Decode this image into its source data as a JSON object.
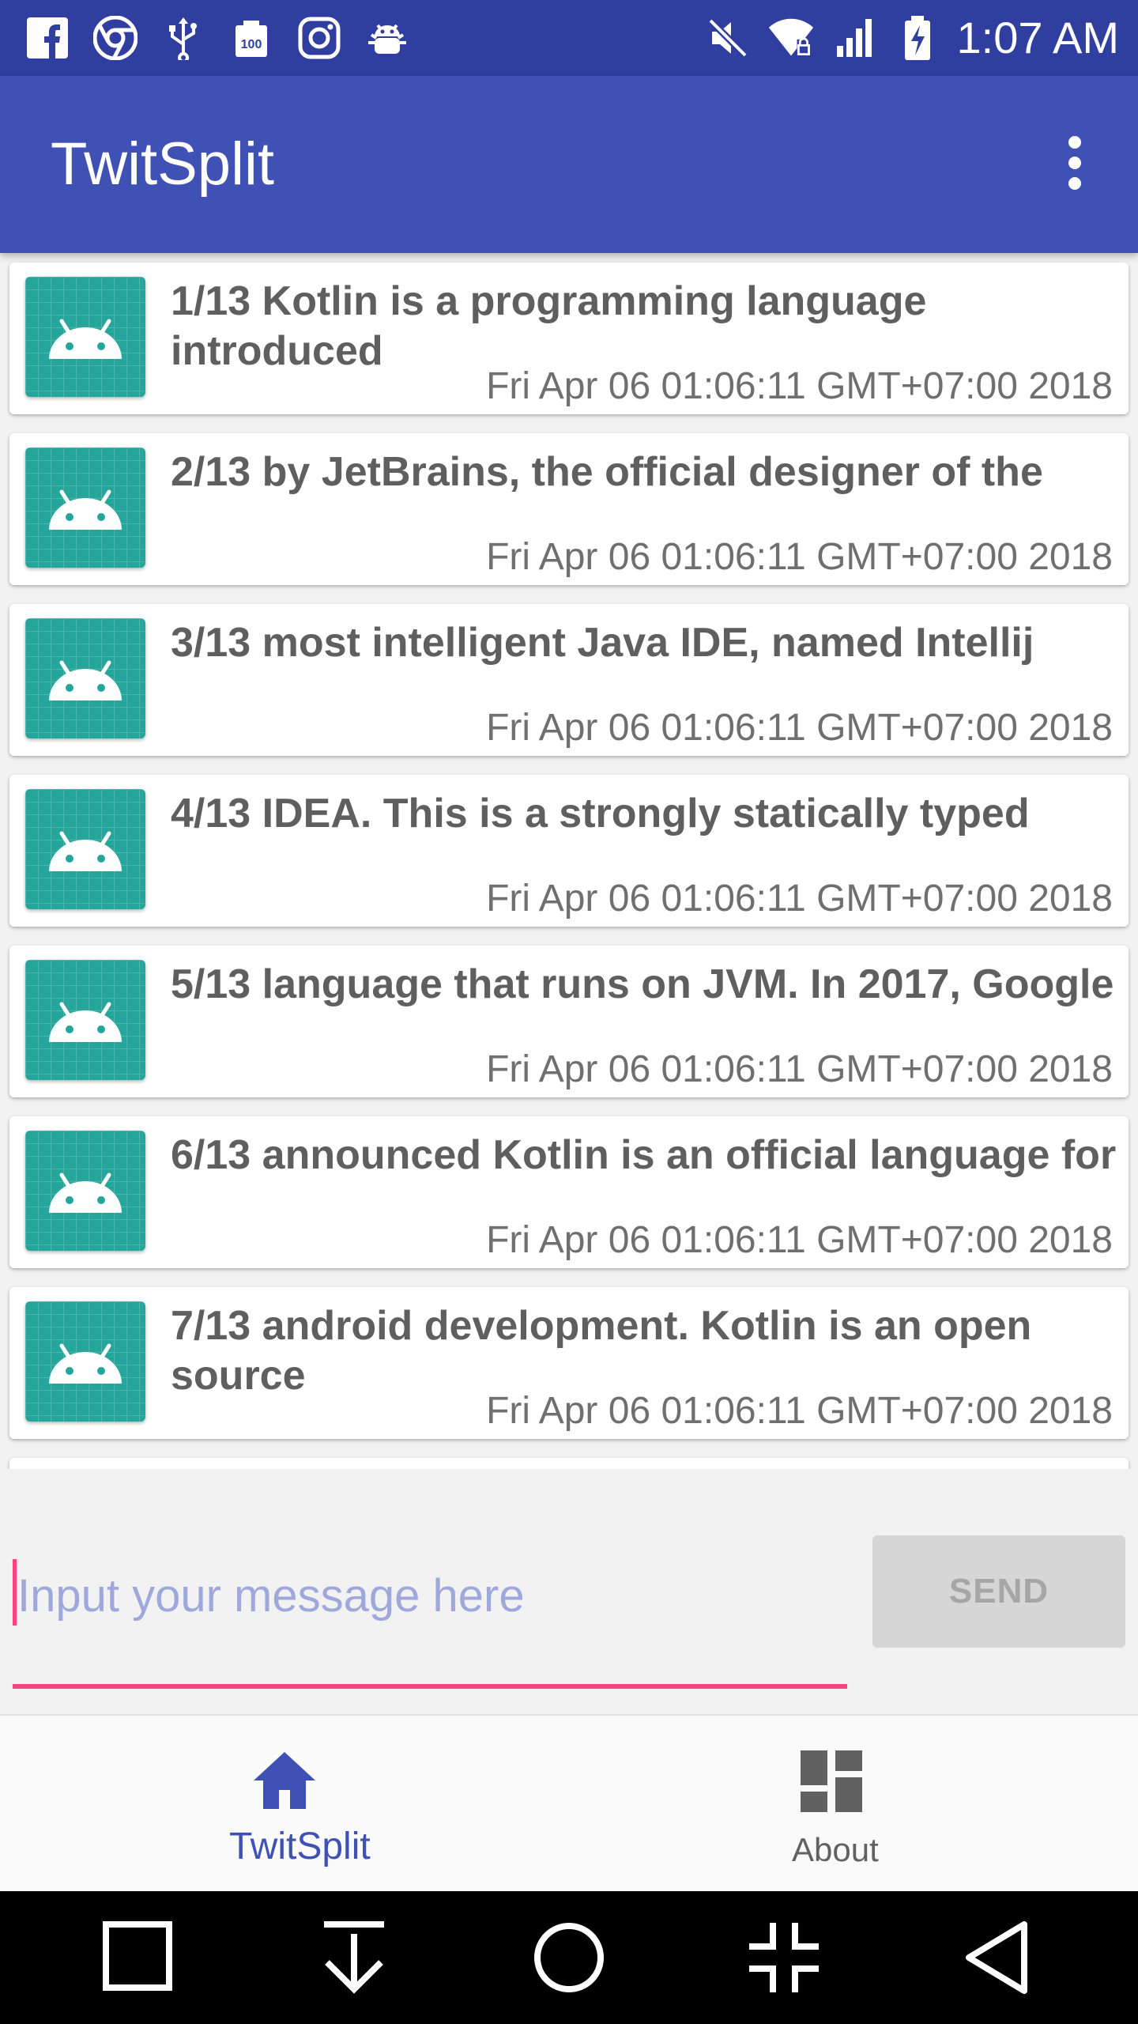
{
  "status_bar": {
    "time": "1:07 AM",
    "left_icons": [
      "facebook-icon",
      "chrome-icon",
      "usb-icon",
      "battery-100-icon",
      "instagram-icon",
      "android-debug-icon"
    ],
    "right_icons": [
      "mute-icon",
      "wifi-icon",
      "signal-icon",
      "battery-charging-icon"
    ]
  },
  "app_bar": {
    "title": "TwitSplit",
    "menu_icon": "more-vert-icon"
  },
  "messages": [
    {
      "text": "1/13 Kotlin is a programming language introduced",
      "time": "Fri Apr 06 01:06:11 GMT+07:00 2018"
    },
    {
      "text": "2/13 by JetBrains, the official designer of the",
      "time": "Fri Apr 06 01:06:11 GMT+07:00 2018"
    },
    {
      "text": "3/13 most intelligent Java IDE, named Intellij",
      "time": "Fri Apr 06 01:06:11 GMT+07:00 2018"
    },
    {
      "text": "4/13 IDEA. This is a strongly statically typed",
      "time": "Fri Apr 06 01:06:11 GMT+07:00 2018"
    },
    {
      "text": "5/13 language that runs on JVM. In 2017, Google",
      "time": "Fri Apr 06 01:06:11 GMT+07:00 2018"
    },
    {
      "text": "6/13 announced Kotlin is an official language for",
      "time": "Fri Apr 06 01:06:11 GMT+07:00 2018"
    },
    {
      "text": "7/13 android development. Kotlin is an open source",
      "time": "Fri Apr 06 01:06:11 GMT+07:00 2018"
    }
  ],
  "composer": {
    "placeholder": "Input your message here",
    "value": "",
    "send_label": "SEND"
  },
  "bottom_nav": [
    {
      "label": "TwitSplit",
      "icon": "home-icon",
      "active": true
    },
    {
      "label": "About",
      "icon": "dashboard-icon",
      "active": false
    }
  ],
  "system_nav": [
    "recents-square-icon",
    "download-arrow-icon",
    "home-circle-icon",
    "collapse-screen-icon",
    "back-triangle-icon"
  ],
  "colors": {
    "status_bar": "#303f9f",
    "primary": "#3f51b5",
    "accent": "#ff4081",
    "avatar_bg": "#26a69a",
    "placeholder": "#9fa8da",
    "nav_active": "#3f51b5",
    "nav_inactive": "#616161"
  }
}
